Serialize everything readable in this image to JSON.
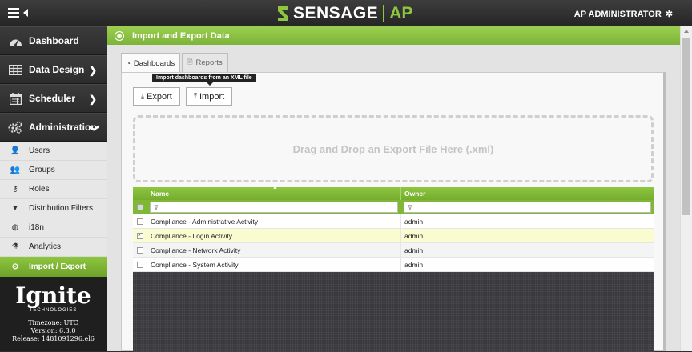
{
  "header": {
    "brand_name": "SENSAGE",
    "brand_suffix": "AP",
    "user_label": "AP ADMINISTRATOR"
  },
  "sidebar": {
    "main_items": [
      {
        "label": "Dashboard",
        "icon": "dashboard-icon"
      },
      {
        "label": "Data Design",
        "icon": "table-icon"
      },
      {
        "label": "Scheduler",
        "icon": "calendar-icon"
      },
      {
        "label": "Administration",
        "icon": "cogs-icon"
      }
    ],
    "admin_items": [
      {
        "label": "Users",
        "icon": "user-icon"
      },
      {
        "label": "Groups",
        "icon": "group-icon"
      },
      {
        "label": "Roles",
        "icon": "key-icon"
      },
      {
        "label": "Distribution Filters",
        "icon": "filter-icon"
      },
      {
        "label": "i18n",
        "icon": "globe-icon"
      },
      {
        "label": "Analytics",
        "icon": "flask-icon"
      }
    ],
    "active_item": "Import / Export",
    "footer": {
      "logo_word": "Ignite",
      "logo_sub": "TECHNOLOGIES",
      "timezone": "Timezone: UTC",
      "version": "Version: 6.3.0",
      "release": "Release: 1481091296.el6"
    }
  },
  "main": {
    "title": "Import and Export Data",
    "tabs": [
      {
        "label": "Dashboards",
        "active": true
      },
      {
        "label": "Reports",
        "active": false
      }
    ],
    "tooltip": "Import dashboards from an XML file",
    "export_label": "Export",
    "import_label": "Import",
    "dropzone_text": "Drag and Drop an Export File Here (.xml)",
    "grid": {
      "columns": [
        "Name",
        "Owner"
      ],
      "rows": [
        {
          "name": "Compliance - Administrative Activity",
          "owner": "admin",
          "checked": false
        },
        {
          "name": "Compliance - Login Activity",
          "owner": "admin",
          "checked": true
        },
        {
          "name": "Compliance - Network Activity",
          "owner": "admin",
          "checked": false
        },
        {
          "name": "Compliance - System Activity",
          "owner": "admin",
          "checked": false
        }
      ]
    }
  },
  "colors": {
    "accent_green": "#8dc63f",
    "topbar": "#2b2b2b"
  }
}
